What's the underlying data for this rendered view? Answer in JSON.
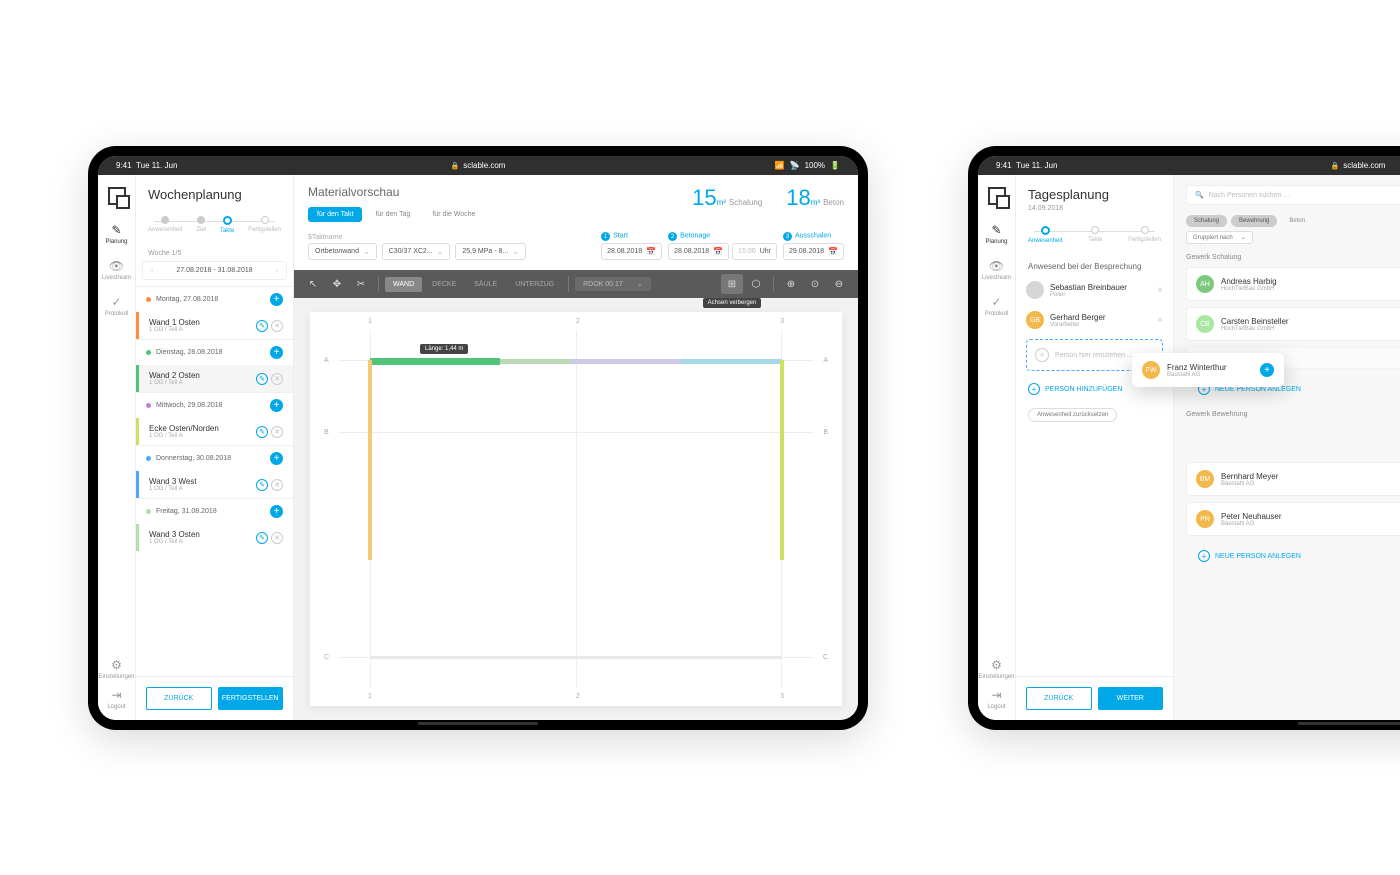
{
  "status": {
    "time": "9:41",
    "date": "Tue 11. Jun",
    "url": "sclable.com",
    "battery": "100%"
  },
  "nav": {
    "planung": "Planung",
    "livestream": "Livestream",
    "protokoll": "Protokoll",
    "einstellungen": "Einstellungen",
    "logout": "Logout"
  },
  "left": {
    "sidebar": {
      "title": "Wochenplanung",
      "steps": [
        "Anwesenheit",
        "Ziel",
        "Takte",
        "Fertigstellen"
      ],
      "activeStep": 2,
      "weekLabel": "Woche 1/5",
      "dateRange": "27.08.2018 - 31.08.2018",
      "days": [
        {
          "label": "Montag, 27.08.2018",
          "color": "#ff8c42",
          "items": [
            {
              "name": "Wand 1 Osten",
              "sub": "1 OG / Teil A",
              "border": "#ff8c42"
            }
          ]
        },
        {
          "label": "Dienstag, 28.08.2018",
          "color": "#4fc37a",
          "items": [
            {
              "name": "Wand 2 Osten",
              "sub": "1 OG / Teil A",
              "border": "#4fc37a",
              "selected": true
            }
          ]
        },
        {
          "label": "Mittwoch, 29.08.2018",
          "color": "#c77dd4",
          "items": [
            {
              "name": "Ecke Osten/Norden",
              "sub": "1 OG / Teil A",
              "border": "#c9e265"
            }
          ]
        },
        {
          "label": "Donnerstag, 30.08.2018",
          "color": "#4aa8ff",
          "items": [
            {
              "name": "Wand 3 West",
              "sub": "1 OG / Teil A",
              "border": "#4aa8ff"
            }
          ]
        },
        {
          "label": "Freitag, 31.08.2018",
          "color": "#b0e0a8",
          "items": [
            {
              "name": "Wand 3 Osten",
              "sub": "1 OG / Teil A",
              "border": "#b0e0a8"
            }
          ]
        }
      ],
      "back": "ZURÜCK",
      "finish": "FERTIGSTELLEN"
    },
    "main": {
      "title": "Materialvorschau",
      "tabs": [
        "für den Takt",
        "für den Tag",
        "für die Woche"
      ],
      "metrics": [
        {
          "val": "15",
          "unit": "m²",
          "label": "Schalung"
        },
        {
          "val": "18",
          "unit": "m³",
          "label": "Beton"
        }
      ],
      "taktname": "$Taktname",
      "selects": [
        "Ortbetonwand",
        "C30/37 XC2...",
        "25,9 MPa - 8..."
      ],
      "stages": [
        {
          "n": "1",
          "label": "Start",
          "date": "28.08.2018"
        },
        {
          "n": "2",
          "label": "Betonage",
          "date": "28.08.2018",
          "time": "15:00",
          "timeUnit": "Uhr"
        },
        {
          "n": "3",
          "label": "Ausschalen",
          "date": "29.08.2018"
        }
      ],
      "toolTabs": [
        "WAND",
        "DECKE",
        "SÄULE",
        "UNTERZUG"
      ],
      "floorSelect": "RDOK 00.17",
      "tooltip": "Achsen verbergen",
      "lengthBadge": "Länge: 1,44 m",
      "gridCols": [
        "1",
        "2",
        "3"
      ],
      "gridRows": [
        "A",
        "B",
        "C"
      ]
    }
  },
  "right": {
    "sidebar": {
      "title": "Tagesplanung",
      "date": "14.09.2018",
      "steps": [
        "Anwesenheit",
        "Takte",
        "Fertigstellen"
      ],
      "section": "Anwesend bei der Besprechung",
      "people": [
        {
          "name": "Sebastian Breinbauer",
          "role": "Polier",
          "bg": "#d6d6d6"
        },
        {
          "name": "Gerhard Berger",
          "role": "Vorarbeiter",
          "bg": "#f2b84b",
          "initials": "GB"
        }
      ],
      "dropPlaceholder": "Person hier reinziehen ...",
      "addPerson": "PERSON HINZUFÜGEN",
      "reset": "Anwesenheit zurücksetzen",
      "back": "ZURÜCK",
      "next": "WEITER"
    },
    "main": {
      "searchPlaceholder": "Nach Personen suchen …",
      "filters": [
        "Schalung",
        "Bewehrung",
        "Beton"
      ],
      "groupBy": "Gruppiert nach",
      "drag": {
        "name": "Franz Winterthur",
        "company": "Baustahl AG",
        "bg": "#f2b84b",
        "initials": "FW"
      },
      "sections": [
        {
          "head": "Gewerk Schalung",
          "people": [
            {
              "name": "Andreas Harbig",
              "company": "HochTiefBau GmbH",
              "bg": "#7fc97f",
              "initials": "AH"
            },
            {
              "name": "Carsten Beinsteller",
              "company": "HochTiefBau GmbH",
              "bg": "#a8e6a1",
              "initials": "CB"
            },
            {
              "name": "",
              "company": "HochTiefBau GmbH",
              "bg": "#eee",
              "hidden": true
            }
          ],
          "action": "NEUE PERSON ANLEGEN"
        },
        {
          "head": "Gewerk Bewehrung",
          "people": [
            {
              "name": "Bernhard Meyer",
              "company": "Baustahl AG",
              "bg": "#f2b84b",
              "initials": "BM"
            },
            {
              "name": "Peter Neuhauser",
              "company": "Baustahl AG",
              "bg": "#f2b84b",
              "initials": "PN"
            }
          ],
          "action": "NEUE PERSON ANLEGEN"
        }
      ]
    }
  }
}
